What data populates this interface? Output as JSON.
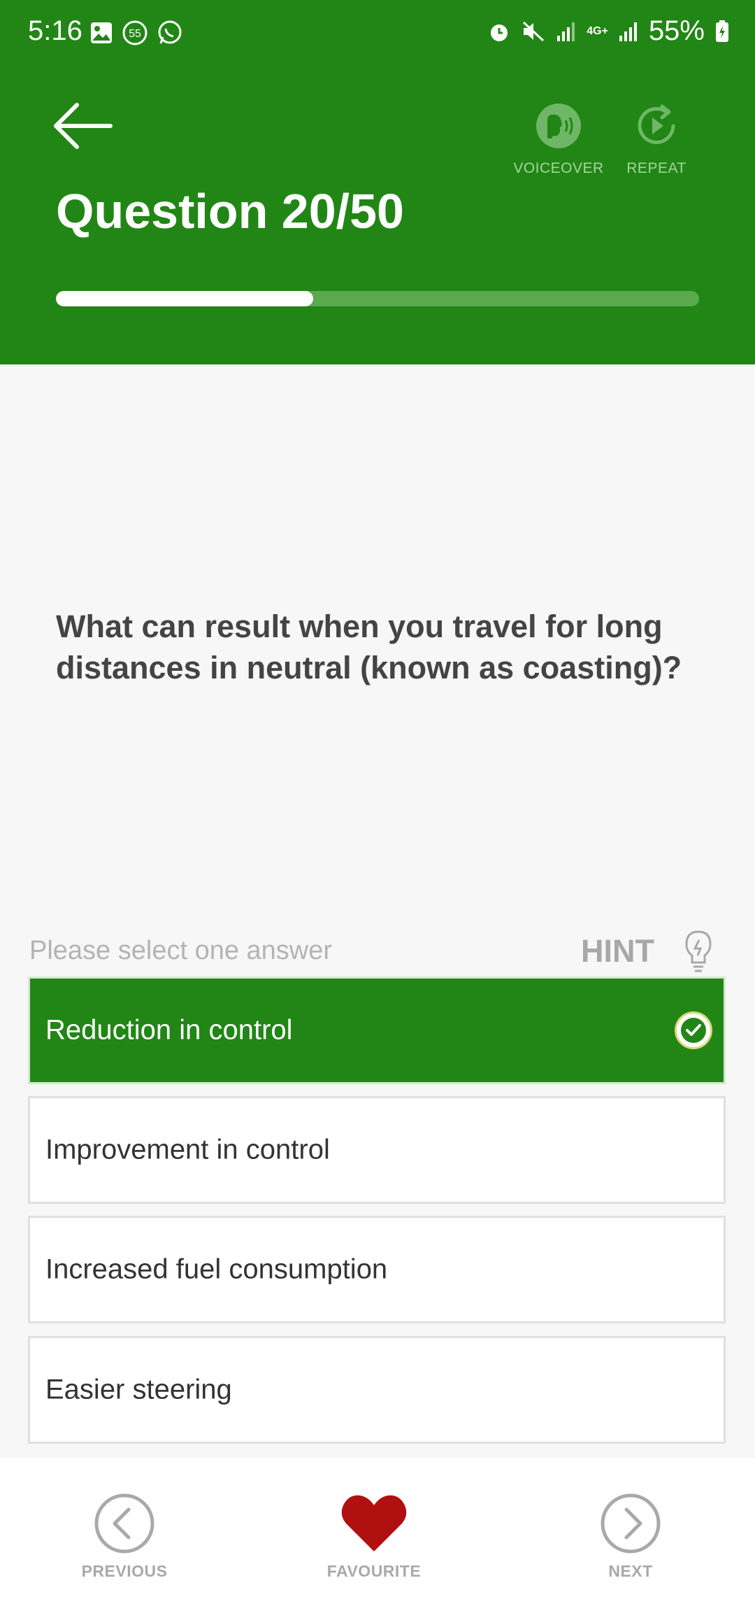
{
  "status_bar": {
    "time": "5:16",
    "notification_badge": "55",
    "network": "4G+",
    "battery": "55%"
  },
  "header": {
    "title": "Question 20/50",
    "voiceover_label": "VOICEOVER",
    "repeat_label": "REPEAT",
    "progress_fraction": 0.4,
    "bg_color": "#218615"
  },
  "question": {
    "text": "What can result when you travel for long distances in neutral (known as coasting)?"
  },
  "answers_section": {
    "instruction": "Please select one answer",
    "hint_label": "HINT",
    "options": [
      {
        "label": "Reduction in control",
        "selected": true
      },
      {
        "label": "Improvement in control",
        "selected": false
      },
      {
        "label": "Increased fuel consumption",
        "selected": false
      },
      {
        "label": "Easier steering",
        "selected": false
      }
    ]
  },
  "footer": {
    "previous_label": "PREVIOUS",
    "favourite_label": "FAVOURITE",
    "next_label": "NEXT",
    "favourite_color": "#b01010"
  }
}
